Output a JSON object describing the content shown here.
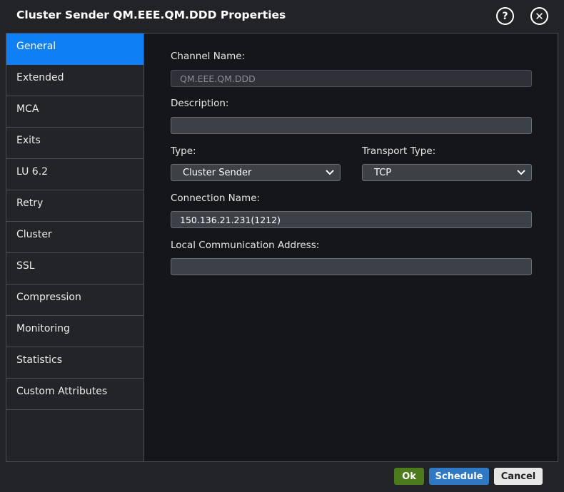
{
  "dialog": {
    "title": "Cluster Sender QM.EEE.QM.DDD Properties",
    "help_symbol": "?",
    "close_symbol": "✕"
  },
  "sidebar": {
    "items": [
      {
        "label": "General",
        "active": true
      },
      {
        "label": "Extended"
      },
      {
        "label": "MCA"
      },
      {
        "label": "Exits"
      },
      {
        "label": "LU 6.2"
      },
      {
        "label": "Retry"
      },
      {
        "label": "Cluster"
      },
      {
        "label": "SSL"
      },
      {
        "label": "Compression"
      },
      {
        "label": "Monitoring"
      },
      {
        "label": "Statistics"
      },
      {
        "label": "Custom Attributes"
      }
    ]
  },
  "form": {
    "channel_name_label": "Channel Name:",
    "channel_name_value": "QM.EEE.QM.DDD",
    "description_label": "Description:",
    "description_value": "",
    "type_label": "Type:",
    "type_value": "Cluster Sender",
    "transport_type_label": "Transport Type:",
    "transport_type_value": "TCP",
    "connection_name_label": "Connection Name:",
    "connection_name_value": "150.136.21.231(1212)",
    "local_address_label": "Local Communication Address:",
    "local_address_value": ""
  },
  "footer": {
    "ok_label": "Ok",
    "schedule_label": "Schedule",
    "cancel_label": "Cancel"
  },
  "colors": {
    "active_tab": "#0f7ff5",
    "ok_button": "#4d7a1c",
    "schedule_button": "#2f78c4",
    "cancel_button": "#e6e6e6"
  }
}
